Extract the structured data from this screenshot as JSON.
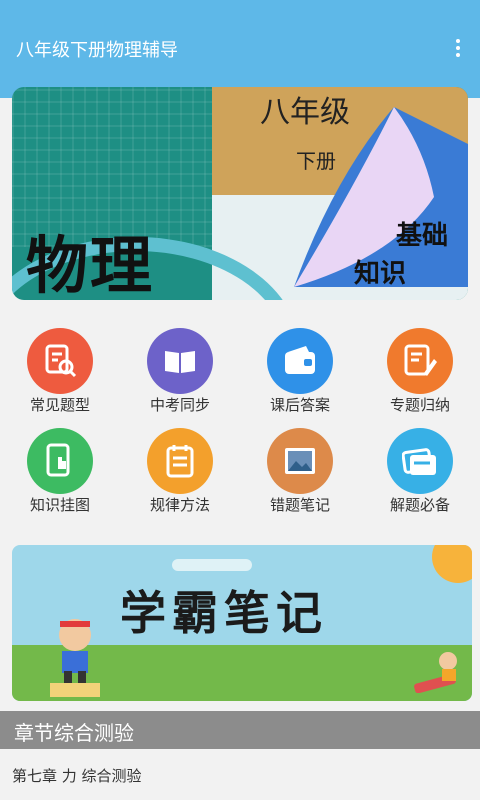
{
  "app_bar": {
    "title": "八年级下册物理辅导"
  },
  "banner_top": {
    "big_text": "物理",
    "grade": "八年级",
    "volume": "下册",
    "tag_line1": "基础",
    "tag_line2": "知识"
  },
  "menu": [
    {
      "label": "常见题型",
      "icon": "document-search-icon",
      "color": "#ee5b3f"
    },
    {
      "label": "中考同步",
      "icon": "open-book-icon",
      "color": "#6d62c9"
    },
    {
      "label": "课后答案",
      "icon": "wallet-icon",
      "color": "#2f91e8"
    },
    {
      "label": "专题归纳",
      "icon": "pencil-note-icon",
      "color": "#f07a2d"
    },
    {
      "label": "知识挂图",
      "icon": "tablet-hand-icon",
      "color": "#3dbb62"
    },
    {
      "label": "规律方法",
      "icon": "notepad-icon",
      "color": "#f3a02c"
    },
    {
      "label": "错题笔记",
      "icon": "picture-icon",
      "color": "#dd8a4a"
    },
    {
      "label": "解题必备",
      "icon": "cards-icon",
      "color": "#37b0e6"
    }
  ],
  "banner_notes": {
    "title": "学霸笔记"
  },
  "section": {
    "title": "章节综合测验"
  },
  "list": [
    {
      "label": "第七章 力 综合测验"
    }
  ]
}
